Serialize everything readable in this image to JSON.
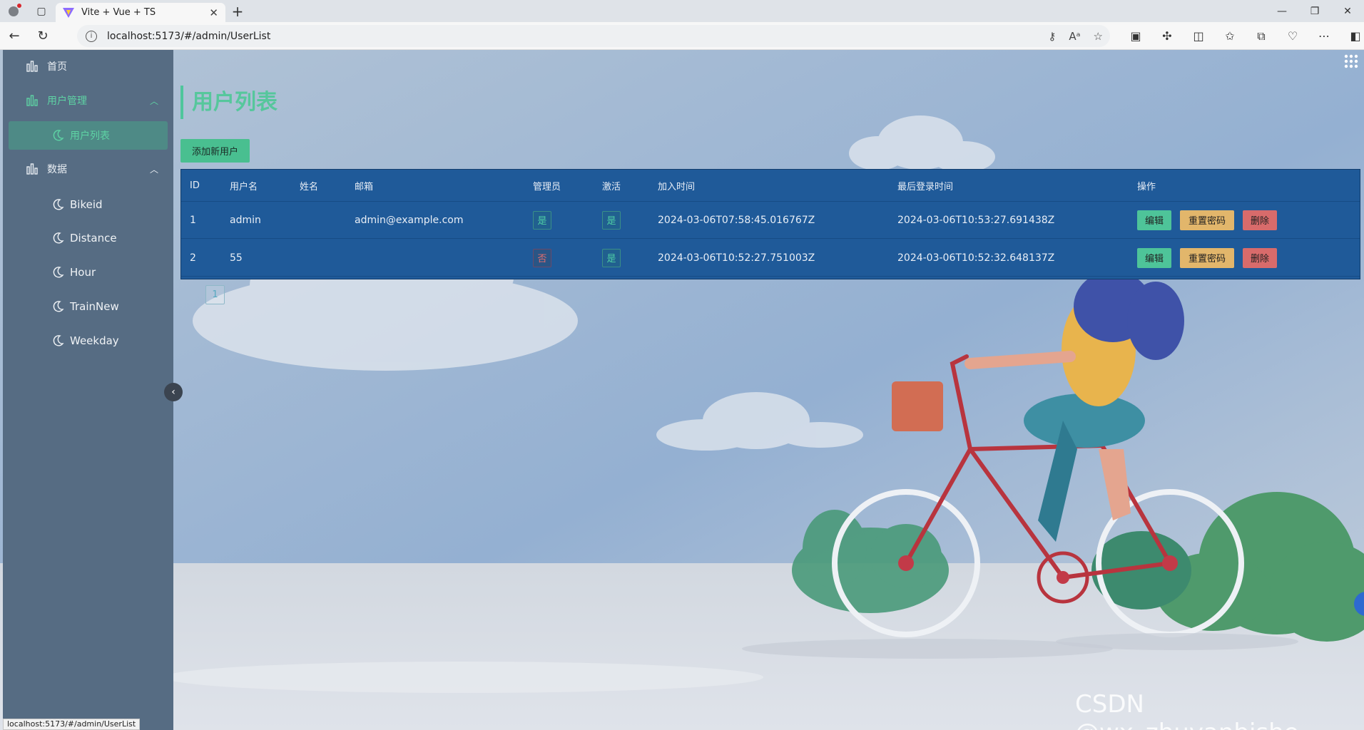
{
  "browser": {
    "tab_title": "Vite + Vue + TS",
    "url": "localhost:5173/#/admin/UserList",
    "status_url": "localhost:5173/#/admin/UserList"
  },
  "sidebar": {
    "home": "首页",
    "user_mgmt": "用户管理",
    "user_list": "用户列表",
    "data": "数据",
    "data_items": [
      "Bikeid",
      "Distance",
      "Hour",
      "TrainNew",
      "Weekday"
    ]
  },
  "page": {
    "title": "用户列表",
    "add_button": "添加新用户"
  },
  "table": {
    "headers": {
      "id": "ID",
      "username": "用户名",
      "name": "姓名",
      "email": "邮箱",
      "admin": "管理员",
      "active": "激活",
      "joined": "加入时间",
      "last_login": "最后登录时间",
      "ops": "操作"
    },
    "rows": [
      {
        "id": "1",
        "username": "admin",
        "name": "",
        "email": "admin@example.com",
        "admin": "是",
        "active": "是",
        "joined": "2024-03-06T07:58:45.016767Z",
        "last_login": "2024-03-06T10:53:27.691438Z"
      },
      {
        "id": "2",
        "username": "55",
        "name": "",
        "email": "",
        "admin": "否",
        "active": "是",
        "joined": "2024-03-06T10:52:27.751003Z",
        "last_login": "2024-03-06T10:52:32.648137Z"
      }
    ],
    "op_labels": {
      "edit": "编辑",
      "reset": "重置密码",
      "delete": "删除"
    }
  },
  "pagination": {
    "current": "1"
  },
  "watermark": "CSDN @wx_zhuyanbishe",
  "colors": {
    "accent": "#4fc69c",
    "table_bg": "#1f5a99",
    "sidebar_bg": "#566c83",
    "reset_btn": "#e2b66b",
    "delete_btn": "#d86b6b"
  }
}
